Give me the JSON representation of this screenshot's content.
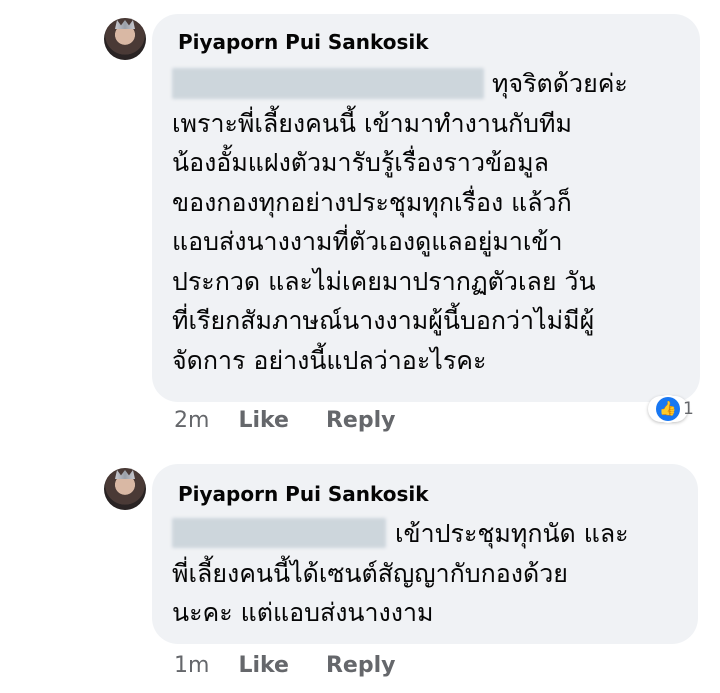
{
  "comments": [
    {
      "author": "Piyaporn Pui Sankosik",
      "lines": [
        "ทุจริตด้วยค่ะ",
        "เพราะพี่เลี้ยงคนนี้ เข้ามาทำงานกับทีม",
        "น้องอั้มแฝงตัวมารับรู้เรื่องราวข้อมูล",
        "ของกองทุกอย่างประชุมทุกเรื่อง แล้วก็",
        "แอบส่งนางงามที่ตัวเองดูแลอยู่มาเข้า",
        "ประกวด และไม่เคยมาปรากฏตัวเลย วัน",
        "ที่เรียกสัมภาษณ์นางงามผู้นี้บอกว่าไม่มีผู้",
        "จัดการ อย่างนี้แปลว่าอะไรคะ"
      ],
      "time": "2m",
      "like_label": "Like",
      "reply_label": "Reply",
      "reaction_icon": "like-thumb-icon",
      "reaction_count": "1"
    },
    {
      "author": "Piyaporn Pui Sankosik",
      "lines": [
        "เข้าประชุมทุกนัด และ",
        "พี่เลี้ยงคนนี้ได้เซนต์สัญญากับกองด้วย",
        "นะคะ แต่แอบส่งนางงาม"
      ],
      "time": "1m",
      "like_label": "Like",
      "reply_label": "Reply"
    }
  ],
  "colors": {
    "bubble": "#f0f2f5",
    "text": "#050505",
    "meta": "#65676b",
    "reaction": "#1877f2"
  }
}
